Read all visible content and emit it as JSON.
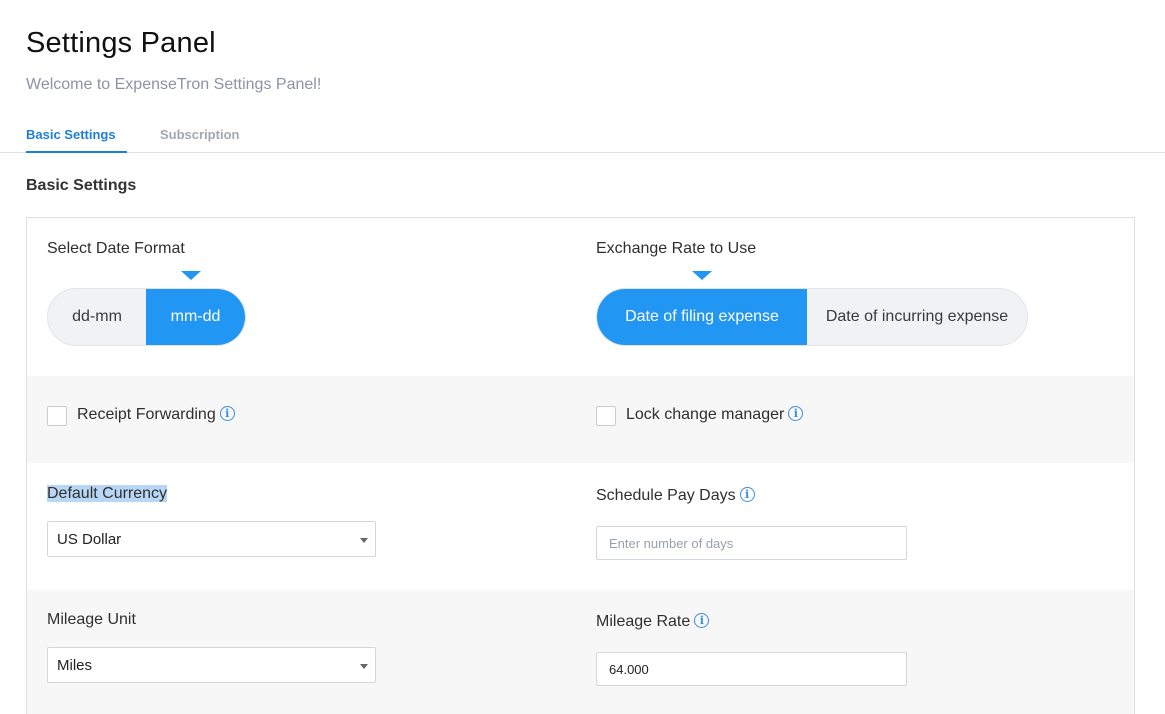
{
  "header": {
    "title": "Settings Panel",
    "subtitle": "Welcome to ExpenseTron Settings Panel!"
  },
  "tabs": [
    {
      "label": "Basic Settings",
      "active": true
    },
    {
      "label": "Subscription",
      "active": false
    }
  ],
  "section_title": "Basic Settings",
  "date_format": {
    "label": "Select Date Format",
    "options": [
      "dd-mm",
      "mm-dd"
    ],
    "selected": "mm-dd"
  },
  "exchange_rate": {
    "label": "Exchange Rate to Use",
    "options": [
      "Date of filing expense",
      "Date of incurring expense"
    ],
    "selected": "Date of filing expense"
  },
  "receipt_forwarding": {
    "label": "Receipt Forwarding",
    "checked": false
  },
  "lock_change_manager": {
    "label": "Lock change manager",
    "checked": false
  },
  "default_currency": {
    "label": "Default Currency",
    "value": "US Dollar"
  },
  "schedule_pay_days": {
    "label": "Schedule Pay Days",
    "placeholder": "Enter number of days"
  },
  "mileage_unit": {
    "label": "Mileage Unit",
    "value": "Miles"
  },
  "mileage_rate": {
    "label": "Mileage Rate",
    "value": "64.000"
  },
  "colors": {
    "accent": "#2196f3",
    "tab_active": "#1f7fd6",
    "row_alt": "#f7f7f8",
    "selection_highlight": "#b8d6f5"
  },
  "icons": {
    "info": "info-circle-icon",
    "dropdown": "caret-down-icon"
  }
}
